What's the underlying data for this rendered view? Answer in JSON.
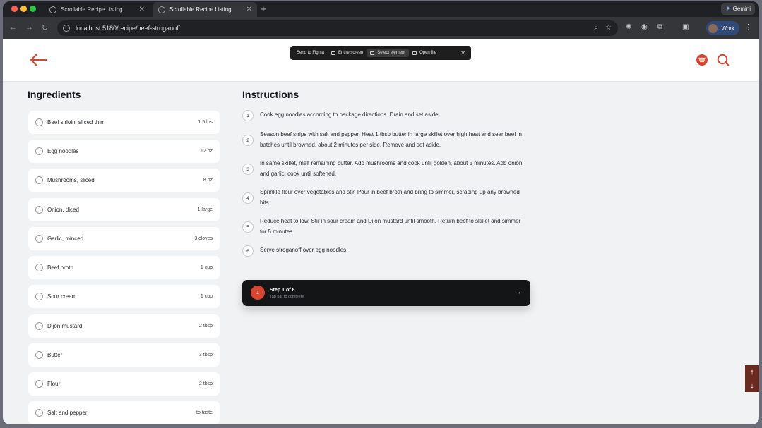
{
  "browser": {
    "tabs": [
      {
        "title": "Scrollable Recipe Listing",
        "active": false
      },
      {
        "title": "Scrollable Recipe Listing",
        "active": true
      }
    ],
    "url": "localhost:5180/recipe/beef-stroganoff",
    "gemini_label": "Gemini",
    "profile_label": "Work"
  },
  "figma_toolbar": {
    "send": "Send to Figma",
    "entire_screen": "Entire screen",
    "select_element": "Select element",
    "open_file": "Open file"
  },
  "ingredients": {
    "title": "Ingredients",
    "items": [
      {
        "name": "Beef sirloin, sliced thin",
        "qty": "1.5 lbs"
      },
      {
        "name": "Egg noodles",
        "qty": "12 oz"
      },
      {
        "name": "Mushrooms, sliced",
        "qty": "8 oz"
      },
      {
        "name": "Onion, diced",
        "qty": "1 large"
      },
      {
        "name": "Garlic, minced",
        "qty": "3 cloves"
      },
      {
        "name": "Beef broth",
        "qty": "1 cup"
      },
      {
        "name": "Sour cream",
        "qty": "1 cup"
      },
      {
        "name": "Dijon mustard",
        "qty": "2 tbsp"
      },
      {
        "name": "Butter",
        "qty": "3 tbsp"
      },
      {
        "name": "Flour",
        "qty": "2 tbsp"
      },
      {
        "name": "Salt and pepper",
        "qty": "to taste"
      }
    ]
  },
  "instructions": {
    "title": "Instructions",
    "steps": [
      {
        "n": "1",
        "text": "Cook egg noodles according to package directions. Drain and set aside."
      },
      {
        "n": "2",
        "text": "Season beef strips with salt and pepper. Heat 1 tbsp butter in large skillet over high heat and sear beef in batches until browned, about 2 minutes per side. Remove and set aside."
      },
      {
        "n": "3",
        "text": "In same skillet, melt remaining butter. Add mushrooms and cook until golden, about 5 minutes. Add onion and garlic, cook until softened."
      },
      {
        "n": "4",
        "text": "Sprinkle flour over vegetables and stir. Pour in beef broth and bring to simmer, scraping up any browned bits."
      },
      {
        "n": "5",
        "text": "Reduce heat to low. Stir in sour cream and Dijon mustard until smooth. Return beef to skillet and simmer for 5 minutes."
      },
      {
        "n": "6",
        "text": "Serve stroganoff over egg noodles."
      }
    ]
  },
  "step_bar": {
    "badge": "1",
    "title": "Step 1 of 6",
    "subtitle": "Tap bar to complete"
  },
  "colors": {
    "accent": "#d9452e",
    "dark_bar": "#141517",
    "page_bg": "#f1f2f4"
  }
}
